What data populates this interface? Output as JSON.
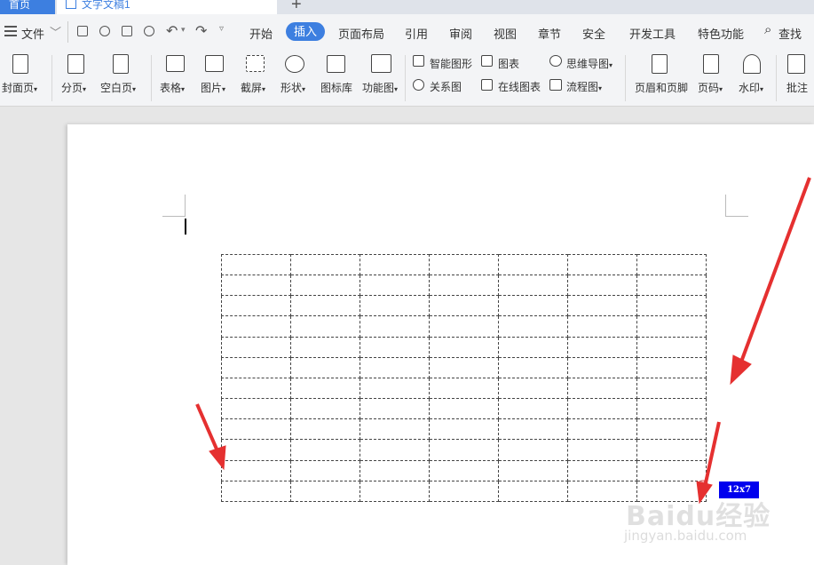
{
  "tabs": {
    "home": "首页",
    "document": "文字文稿1"
  },
  "menu": {
    "file": "文件",
    "items": [
      "开始",
      "插入",
      "页面布局",
      "引用",
      "审阅",
      "视图",
      "章节",
      "安全",
      "开发工具",
      "特色功能"
    ],
    "active": "插入",
    "search": "查找"
  },
  "ribbon": {
    "cover": "封面页",
    "pagebreak": "分页",
    "blankpage": "空白页",
    "table": "表格",
    "picture": "图片",
    "screenshot": "截屏",
    "shape": "形状",
    "iconlib": "图标库",
    "funcchart": "功能图",
    "smartart": "智能图形",
    "relation": "关系图",
    "chart": "图表",
    "onlinechart": "在线图表",
    "mindmap": "思维导图",
    "flowchart": "流程图",
    "headerfooter": "页眉和页脚",
    "pagenum": "页码",
    "watermark": "水印",
    "comment": "批注"
  },
  "table_grid": {
    "rows": 12,
    "cols": 7,
    "size_label": "12x7"
  },
  "watermark": {
    "logo": "Baidu经验",
    "url": "jingyan.baidu.com"
  },
  "colors": {
    "accent": "#3d7fe0",
    "badge": "#0000ee",
    "arrow": "#e53030"
  }
}
